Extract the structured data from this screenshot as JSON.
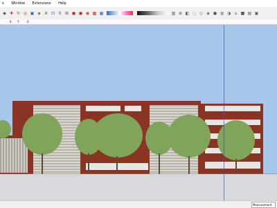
{
  "menu": {
    "items": [
      "s",
      "Window",
      "Extensions",
      "Help"
    ]
  },
  "vcb": {
    "fields": [
      "0",
      "7",
      "0"
    ]
  },
  "status": {
    "measurements_label": "Measurement"
  },
  "colors": {
    "sky": "#a8c8ea",
    "brick": "#8a3423",
    "ground": "#d7d9dc"
  }
}
